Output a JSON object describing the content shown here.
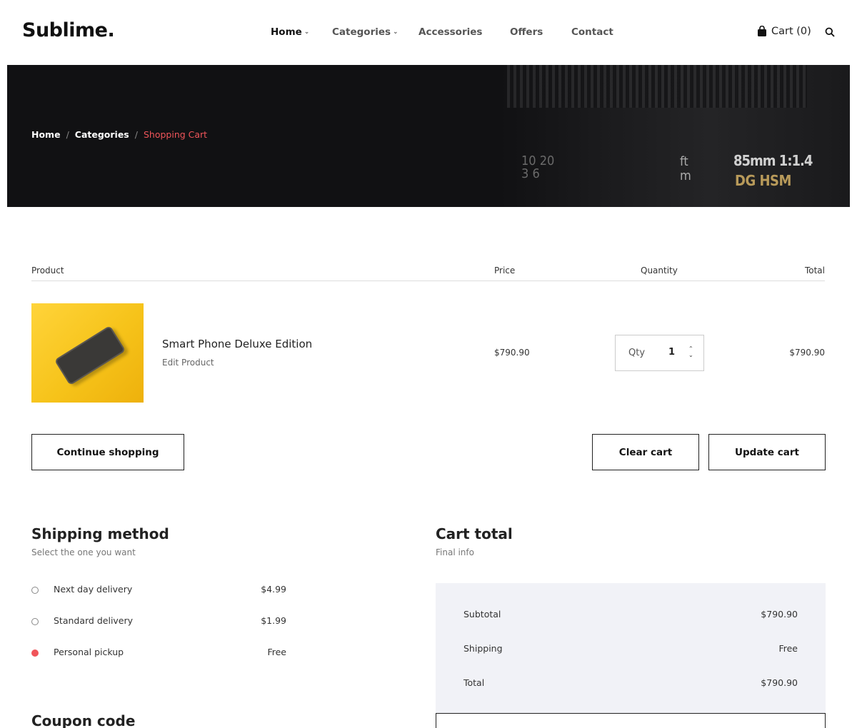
{
  "header": {
    "logo": "Sublime.",
    "nav": [
      {
        "label": "Home",
        "has_dropdown": true,
        "active": true
      },
      {
        "label": "Categories",
        "has_dropdown": true,
        "active": false
      },
      {
        "label": "Accessories",
        "has_dropdown": false,
        "active": false
      },
      {
        "label": "Offers",
        "has_dropdown": false,
        "active": false
      },
      {
        "label": "Contact",
        "has_dropdown": false,
        "active": false
      }
    ],
    "cart_label": "Cart (0)",
    "cart_icon": "shopping-bag-icon",
    "search_icon": "search-icon"
  },
  "banner": {
    "breadcrumb": [
      "Home",
      "Categories",
      "Shopping Cart"
    ],
    "lens_text_1": "85mm 1:1.4",
    "lens_text_2": "DG HSM",
    "lens_text_3": "ft",
    "lens_text_4": "m",
    "lens_text_5": "10 20",
    "lens_text_6": "3 6",
    "accent_color": "#f0555a"
  },
  "cart_table": {
    "headers": {
      "product": "Product",
      "price": "Price",
      "quantity": "Quantity",
      "total": "Total"
    },
    "items": [
      {
        "name": "Smart Phone Deluxe Edition",
        "edit_label": "Edit Product",
        "price": "$790.90",
        "qty_label": "Qty",
        "qty": "1",
        "total": "$790.90"
      }
    ]
  },
  "actions": {
    "continue": "Continue shopping",
    "clear": "Clear cart",
    "update": "Update cart"
  },
  "shipping": {
    "title": "Shipping method",
    "subtitle": "Select the one you want",
    "options": [
      {
        "label": "Next day delivery",
        "price": "$4.99",
        "selected": false
      },
      {
        "label": "Standard delivery",
        "price": "$1.99",
        "selected": false
      },
      {
        "label": "Personal pickup",
        "price": "Free",
        "selected": true
      }
    ]
  },
  "coupon": {
    "title": "Coupon code"
  },
  "cart_total": {
    "title": "Cart total",
    "subtitle": "Final info",
    "rows": [
      {
        "label": "Subtotal",
        "value": "$790.90"
      },
      {
        "label": "Shipping",
        "value": "Free"
      },
      {
        "label": "Total",
        "value": "$790.90"
      }
    ]
  }
}
